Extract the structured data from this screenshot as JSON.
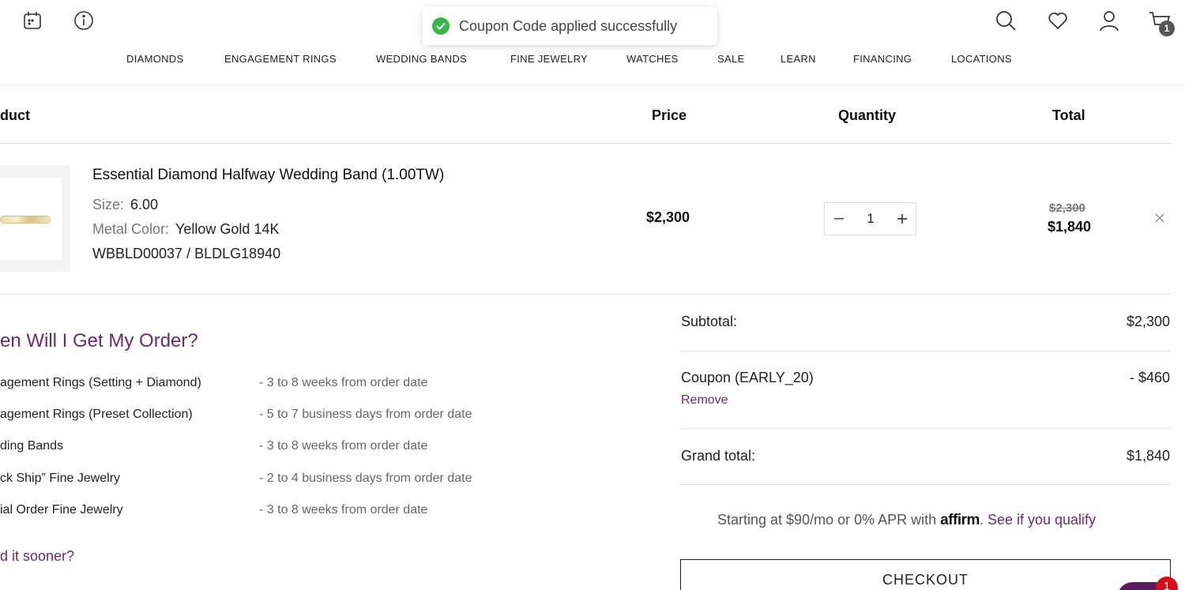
{
  "header": {
    "cart_count": "1",
    "nav": [
      "DIAMONDS",
      "ENGAGEMENT RINGS",
      "WEDDING BANDS",
      "FINE JEWELRY",
      "WATCHES",
      "SALE",
      "LEARN",
      "FINANCING",
      "LOCATIONS"
    ]
  },
  "toast": {
    "message": "Coupon Code applied successfully"
  },
  "table": {
    "headers": {
      "product": "duct",
      "price": "Price",
      "quantity": "Quantity",
      "total": "Total"
    }
  },
  "item": {
    "title": "Essential Diamond Halfway Wedding Band (1.00TW)",
    "size_label": "Size:",
    "size_value": "6.00",
    "metal_label": "Metal Color:",
    "metal_value": "Yellow Gold 14K",
    "sku": "WBBLD00037 / BLDLG18940",
    "price": "$2,300",
    "quantity": "1",
    "old_total": "$2,300",
    "new_total": "$1,840"
  },
  "delivery": {
    "title": "en Will I Get My Order?",
    "rows": [
      {
        "label": "agement Rings (Setting + Diamond)",
        "value": "-  3 to 8 weeks from order date"
      },
      {
        "label": "agement Rings (Preset Collection)",
        "value": "-  5 to 7 business days from order date"
      },
      {
        "label": "ding Bands",
        "value": "-  3 to 8 weeks from order date"
      },
      {
        "label": "ck Ship” Fine Jewelry",
        "value": "-  2 to 4 business days from order date"
      },
      {
        "label": "ial Order Fine Jewelry",
        "value": "-  3 to 8 weeks from order date"
      }
    ],
    "need_sooner": "d it sooner?"
  },
  "summary": {
    "subtotal_label": "Subtotal:",
    "subtotal_value": "$2,300",
    "coupon_label": "Coupon (EARLY_20)",
    "coupon_value": "- $460",
    "remove_label": "Remove",
    "grand_label": "Grand total:",
    "grand_value": "$1,840",
    "affirm_prefix": "Starting at $90/mo or 0% APR with ",
    "affirm_logo": "affirm",
    "affirm_link": "See if you qualify",
    "checkout_label": "CHECKOUT"
  },
  "chat": {
    "badge": "1"
  },
  "colors": {
    "accent": "#6a2a6e",
    "success": "#3ab54a",
    "badge_red": "#d0101a"
  },
  "icons": [
    "calendar-icon",
    "info-icon",
    "search-icon",
    "heart-icon",
    "user-icon",
    "cart-icon",
    "check-icon",
    "close-icon",
    "minus-icon",
    "plus-icon"
  ]
}
